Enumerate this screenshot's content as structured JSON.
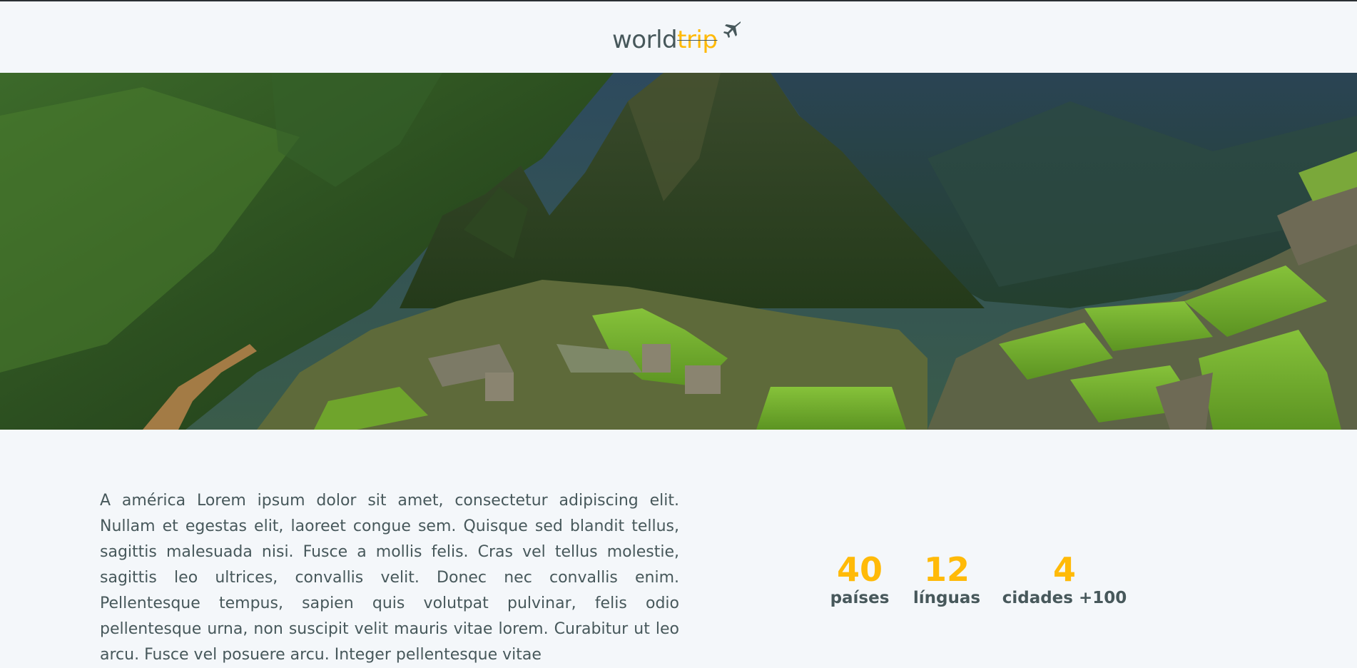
{
  "header": {
    "logo_world": "world",
    "logo_trip": "trip",
    "logo_icon": "airplane-icon"
  },
  "hero": {
    "image_subject": "Machu Picchu",
    "colors": {
      "sky": "#33495e",
      "mountain": "#2f4a24",
      "grass": "#6fae2a",
      "stone": "#6e6a55",
      "river": "#a37b45"
    }
  },
  "content": {
    "paragraph": "A américa Lorem ipsum dolor sit amet, consectetur adipiscing elit. Nullam et egestas elit, laoreet congue sem. Quisque sed blandit tellus, sagittis malesuada nisi. Fusce a mollis felis. Cras vel tellus molestie, sagittis leo ultrices, convallis velit. Donec nec convallis enim. Pellentesque tempus, sapien quis volutpat pulvinar, felis odio pellentesque urna, non suscipit velit mauris vitae lorem. Curabitur ut leo arcu. Fusce vel posuere arcu. Integer pellentesque vitae",
    "stats": [
      {
        "number": "40",
        "label": "países"
      },
      {
        "number": "12",
        "label": "línguas"
      },
      {
        "number": "4",
        "label": "cidades +100"
      }
    ]
  },
  "colors": {
    "accent": "#ffba08",
    "text": "#47585b",
    "background": "#f4f7fa"
  }
}
